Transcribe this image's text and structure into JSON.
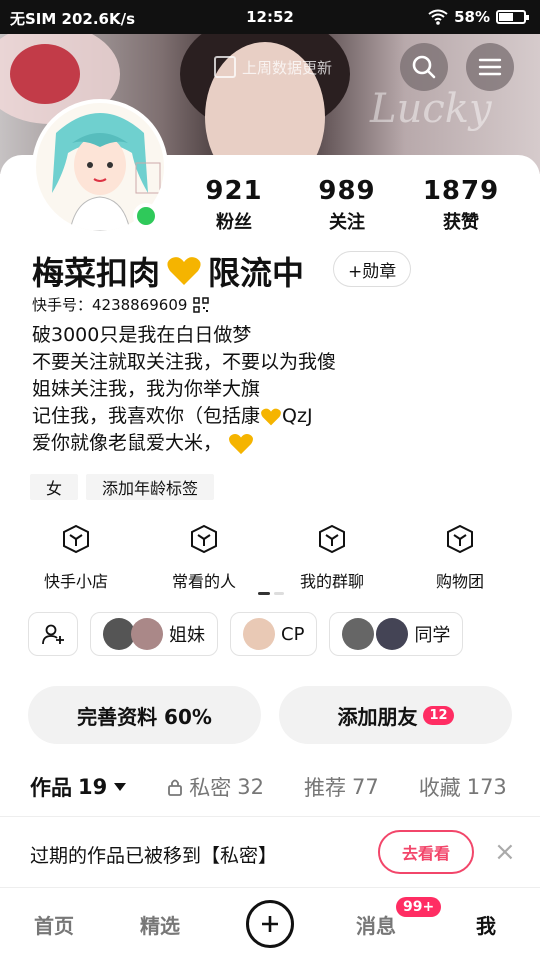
{
  "status_bar": {
    "left": "无SIM 202.6K/s",
    "time": "12:52",
    "battery": "58%"
  },
  "banner": {
    "watermark": "上周数据更新",
    "overlay_text": "Lucky"
  },
  "stats": [
    {
      "value": "921",
      "label": "粉丝"
    },
    {
      "value": "989",
      "label": "关注"
    },
    {
      "value": "1879",
      "label": "获赞"
    }
  ],
  "profile": {
    "name": "梅菜扣肉",
    "name_suffix": "限流中",
    "badge_button": "+勋章",
    "kuaishou_id": "快手号：4238869609",
    "bio": [
      "破3000只是我在白日做梦",
      "不要关注就取关注我，不要以为我傻",
      "姐妹关注我，我为你举大旗",
      "记住我，我喜欢你（包括康",
      "爱你就像老鼠爱大米，"
    ],
    "bio_line4_suffix": "QzJ",
    "tags": [
      "女",
      "添加年龄标签"
    ]
  },
  "shortcuts": [
    "快手小店",
    "常看的人",
    "我的群聊",
    "购物团"
  ],
  "groups": [
    {
      "label": "姐妹"
    },
    {
      "label": "CP"
    },
    {
      "label": "同学"
    }
  ],
  "actions": {
    "complete_profile": "完善资料 60%",
    "add_friends": "添加朋友",
    "add_friends_count": "12"
  },
  "tabs": [
    {
      "label": "作品",
      "count": "19"
    },
    {
      "label": "私密",
      "count": "32"
    },
    {
      "label": "推荐",
      "count": "77"
    },
    {
      "label": "收藏",
      "count": "173"
    }
  ],
  "notice": {
    "text": "过期的作品已被移到【私密】",
    "button": "去看看",
    "close": "×"
  },
  "bottom_nav": {
    "home": "首页",
    "featured": "精选",
    "messages": "消息",
    "messages_badge": "99+",
    "me": "我"
  },
  "colors": {
    "accent": "#f2466a",
    "badge": "#ff2d63",
    "online": "#2fc95a",
    "heart": "#f5b400"
  }
}
